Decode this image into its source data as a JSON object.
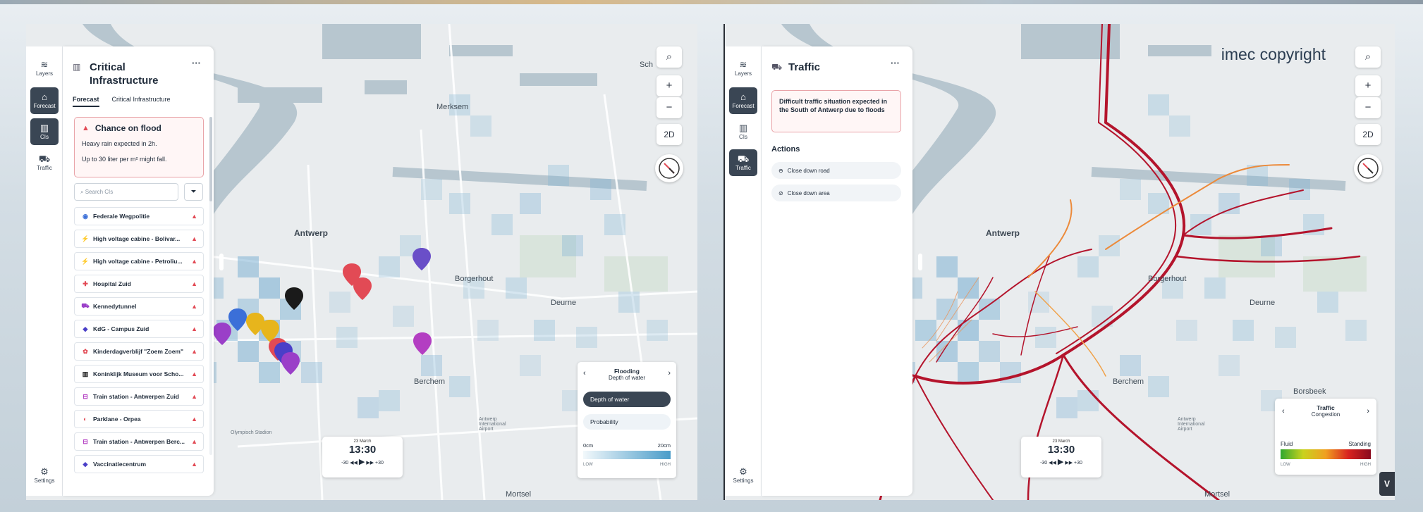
{
  "left": {
    "rail": [
      {
        "label": "Layers",
        "icon": "layers-icon",
        "glyph": "≋",
        "active": false
      },
      {
        "label": "Forecast",
        "icon": "forecast-icon",
        "glyph": "⌂",
        "active": true
      },
      {
        "label": "CIs",
        "icon": "ci-icon",
        "glyph": "▥",
        "active": true
      },
      {
        "label": "Traffic",
        "icon": "car-icon",
        "glyph": "⛟",
        "active": false
      }
    ],
    "settings_label": "Settings",
    "panel_title": "Critical Infrastructure",
    "panel_title_line1": "Critical",
    "panel_title_line2": "Infrastructure",
    "more": "···",
    "tabs": [
      "Forecast",
      "Critical Infrastructure"
    ],
    "alert": {
      "title": "Chance on flood",
      "line1": "Heavy rain expected in 2h.",
      "line2": "Up to 30 liter per m² might fall."
    },
    "search_placeholder": "Search CIs",
    "ci_items": [
      {
        "name": "Federale Wegpolitie",
        "glyph": "◉",
        "color": "#3b6fd8"
      },
      {
        "name": "High voltage cabine - Bolivar...",
        "glyph": "⚡",
        "color": "#e7b51c"
      },
      {
        "name": "High voltage cabine - Petroliu...",
        "glyph": "⚡",
        "color": "#e7b51c"
      },
      {
        "name": "Hospital Zuid",
        "glyph": "✚",
        "color": "#e24a55"
      },
      {
        "name": "Kennedytunnel",
        "glyph": "⛟",
        "color": "#9a3fc8"
      },
      {
        "name": "KdG - Campus Zuid",
        "glyph": "◆",
        "color": "#4a3fc8"
      },
      {
        "name": "Kinderdagverblijf \"Zoem Zoem\"",
        "glyph": "✿",
        "color": "#e24a55"
      },
      {
        "name": "Koninklijk Museum voor Scho...",
        "glyph": "▥",
        "color": "#222"
      },
      {
        "name": "Train station - Antwerpen Zuid",
        "glyph": "⊟",
        "color": "#b33ec2"
      },
      {
        "name": "Parklane - Orpea",
        "glyph": "◐",
        "color": "#e24a55"
      },
      {
        "name": "Train station - Antwerpen Berc...",
        "glyph": "⊟",
        "color": "#b33ec2"
      },
      {
        "name": "Vaccinatiecentrum",
        "glyph": "◆",
        "color": "#4a3fc8"
      }
    ],
    "map_labels": {
      "antwerp": "Antwerp",
      "merksem": "Merksem",
      "borgerhout": "Borgerhout",
      "deurne": "Deurne",
      "berchem": "Berchem",
      "airport": "Antwerp International Airport",
      "mortsel": "Mortsel",
      "olympisch": "Olympisch Stadion",
      "schoten": "Sch"
    },
    "zoom_in": "+",
    "zoom_out": "−",
    "view_mode": "2D",
    "time": {
      "date": "23 March",
      "clock": "13:30",
      "back": "-30",
      "forward": "+30"
    },
    "legend": {
      "title": "Flooding",
      "subtitle": "Depth of water",
      "option_selected": "Depth of water",
      "option_other": "Probability",
      "min": "0cm",
      "max": "20cm",
      "low": "LOW",
      "high": "HIGH"
    }
  },
  "right": {
    "rail": [
      {
        "label": "Layers",
        "icon": "layers-icon",
        "glyph": "≋",
        "active": false
      },
      {
        "label": "Forecast",
        "icon": "forecast-icon",
        "glyph": "⌂",
        "active": true
      },
      {
        "label": "CIs",
        "icon": "ci-icon",
        "glyph": "▥",
        "active": false
      },
      {
        "label": "Traffic",
        "icon": "car-icon",
        "glyph": "⛟",
        "active": true
      }
    ],
    "settings_label": "Settings",
    "panel_title": "Traffic",
    "more": "···",
    "notice": "Difficult traffic situation expected in the South of Antwerp due to floods",
    "actions_title": "Actions",
    "actions": [
      "Close down road",
      "Close down area"
    ],
    "copyright": "imec copyright",
    "map_labels": {
      "antwerp": "Antwerp",
      "borgerhout": "Borgerhout",
      "deurne": "Deurne",
      "berchem": "Berchem",
      "borsbeek": "Borsbeek",
      "airport": "Antwerp International Airport",
      "mortsel": "Mortsel"
    },
    "zoom_in": "+",
    "zoom_out": "−",
    "view_mode": "2D",
    "time": {
      "date": "23 March",
      "clock": "13:30",
      "back": "-30",
      "forward": "+30"
    },
    "legend": {
      "title": "Traffic",
      "subtitle": "Congestion",
      "min": "Fluid",
      "max": "Standing",
      "low": "LOW",
      "high": "HIGH"
    },
    "badge": "V"
  },
  "colors": {
    "accent_dark": "#3a4654",
    "alert_red": "#e24a55",
    "flood_blue": "#5aa7cf",
    "traffic_red": "#b4142c",
    "traffic_orange": "#ec8a3a"
  }
}
